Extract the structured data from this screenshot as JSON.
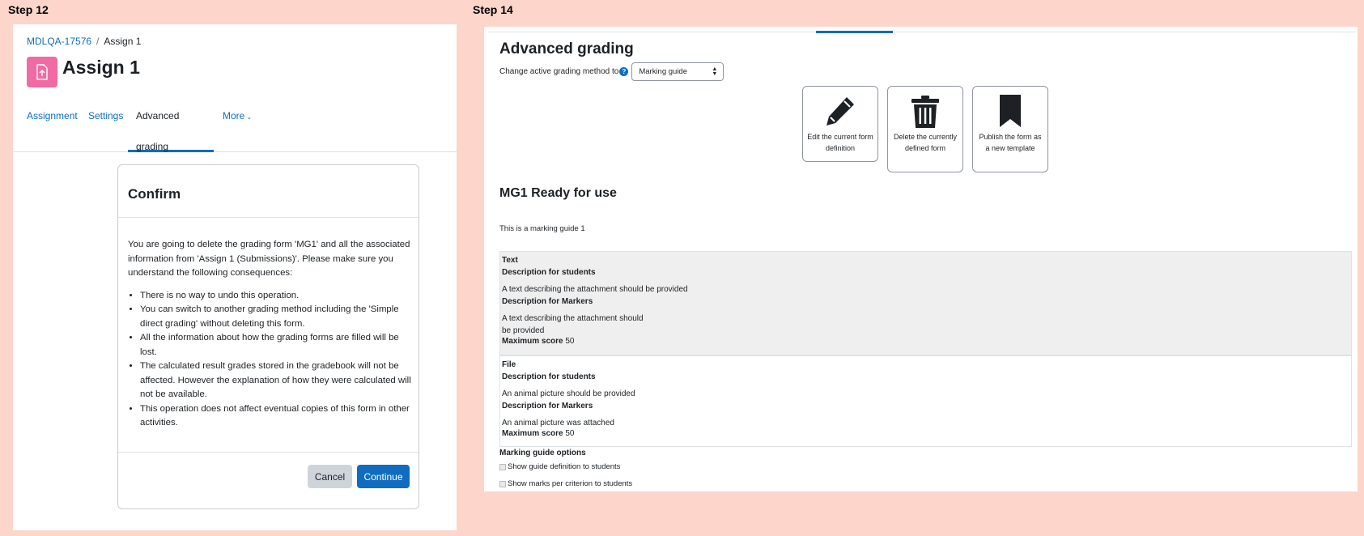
{
  "step12": {
    "label": "Step 12",
    "breadcrumb": {
      "course": "MDLQA-17576",
      "separator": "/",
      "current": "Assign 1"
    },
    "title": "Assign 1",
    "tabs": [
      {
        "label": "Assignment"
      },
      {
        "label": "Settings"
      },
      {
        "label": "Advanced grading"
      },
      {
        "label": "More"
      }
    ],
    "modal": {
      "title": "Confirm",
      "intro": "You are going to delete the grading form 'MG1' and all the associated information from 'Assign 1 (Submissions)'. Please make sure you understand the following consequences:",
      "bullets": [
        "There is no way to undo this operation.",
        "You can switch to another grading method including the 'Simple direct grading' without deleting this form.",
        "All the information about how the grading forms are filled will be lost.",
        "The calculated result grades stored in the gradebook will not be affected. However the explanation of how they were calculated will not be available.",
        "This operation does not affect eventual copies of this form in other activities."
      ],
      "cancel": "Cancel",
      "continue": "Continue"
    }
  },
  "step14": {
    "label": "Step 14",
    "title": "Advanced grading",
    "change_label": "Change active grading method to",
    "select_value": "Marking guide",
    "actions": [
      {
        "label": "Edit the current form definition",
        "icon": "pencil-icon"
      },
      {
        "label": "Delete the currently defined form",
        "icon": "trash-icon"
      },
      {
        "label": "Publish the form as a new template",
        "icon": "bookmark-icon"
      }
    ],
    "guide_title": "MG1 Ready for use",
    "guide_description": "This is a marking guide 1",
    "criteria": [
      {
        "name": "Text",
        "students_heading": "Description for students",
        "students_text": "A text describing the attachment should be provided",
        "markers_heading": "Description for Markers",
        "markers_text": "A text describing the attachment should be provided",
        "max_label": "Maximum score",
        "max_value": "50"
      },
      {
        "name": "File",
        "students_heading": "Description for students",
        "students_text": "An animal picture should be provided",
        "markers_heading": "Description for Markers",
        "markers_text": "An animal picture was attached",
        "max_label": "Maximum score",
        "max_value": "50"
      }
    ],
    "options_title": "Marking guide options",
    "options": [
      {
        "label": "Show guide definition to students"
      },
      {
        "label": "Show marks per criterion to students"
      }
    ]
  },
  "colors": {
    "accent": "#0f6cbf",
    "course_icon": "#f06ba3",
    "background": "#fdd5ca"
  }
}
